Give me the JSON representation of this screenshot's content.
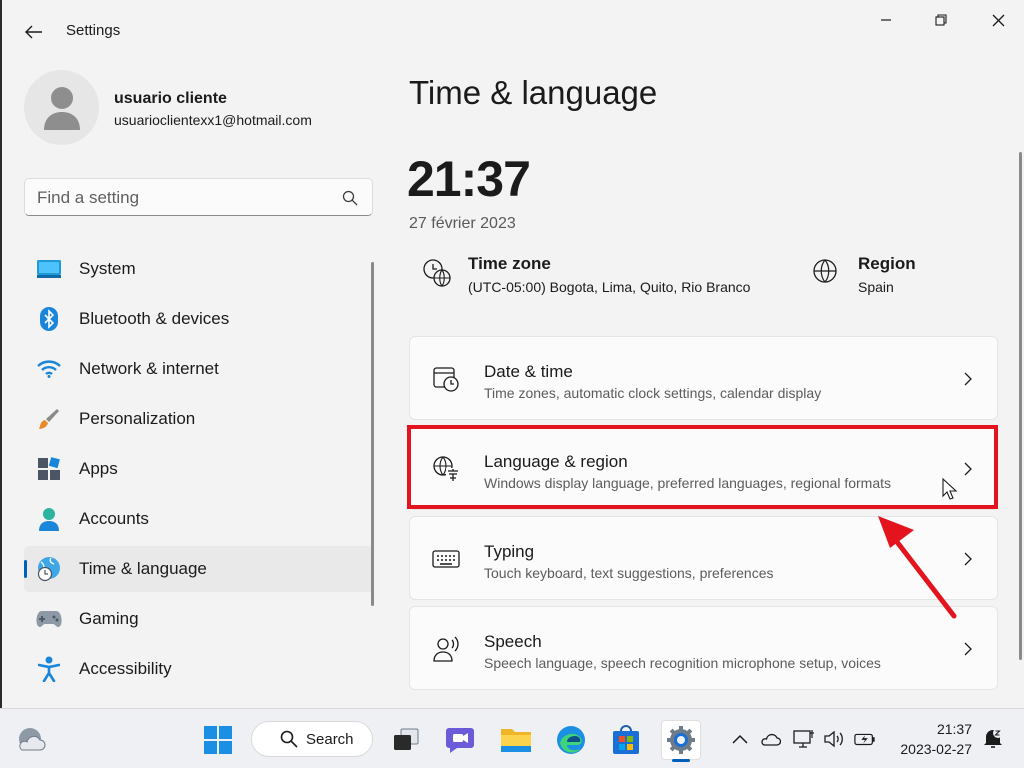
{
  "window": {
    "title": "Settings"
  },
  "profile": {
    "name": "usuario cliente",
    "email": "usuarioclientexx1@hotmail.com"
  },
  "search": {
    "placeholder": "Find a setting"
  },
  "sidebar": {
    "items": [
      {
        "label": "System",
        "icon": "system-icon"
      },
      {
        "label": "Bluetooth & devices",
        "icon": "bluetooth-icon"
      },
      {
        "label": "Network & internet",
        "icon": "wifi-icon"
      },
      {
        "label": "Personalization",
        "icon": "brush-icon"
      },
      {
        "label": "Apps",
        "icon": "apps-icon"
      },
      {
        "label": "Accounts",
        "icon": "accounts-icon"
      },
      {
        "label": "Time & language",
        "icon": "time-language-icon",
        "selected": true
      },
      {
        "label": "Gaming",
        "icon": "gamepad-icon"
      },
      {
        "label": "Accessibility",
        "icon": "accessibility-icon"
      }
    ]
  },
  "main": {
    "title": "Time & language",
    "time": "21:37",
    "date": "27 février 2023",
    "time_zone": {
      "label": "Time zone",
      "value": "(UTC-05:00) Bogota, Lima, Quito, Rio Branco"
    },
    "region": {
      "label": "Region",
      "value": "Spain"
    },
    "cards": [
      {
        "title": "Date & time",
        "subtitle": "Time zones, automatic clock settings, calendar display",
        "icon": "calendar-clock-icon"
      },
      {
        "title": "Language & region",
        "subtitle": "Windows display language, preferred languages, regional formats",
        "icon": "language-icon"
      },
      {
        "title": "Typing",
        "subtitle": "Touch keyboard, text suggestions, preferences",
        "icon": "keyboard-icon"
      },
      {
        "title": "Speech",
        "subtitle": "Speech language, speech recognition microphone setup, voices",
        "icon": "speech-icon"
      }
    ]
  },
  "taskbar": {
    "search_label": "Search",
    "time": "21:37",
    "date": "2023-02-27"
  },
  "colors": {
    "accent": "#005fb8",
    "highlight": "#e3141e"
  }
}
